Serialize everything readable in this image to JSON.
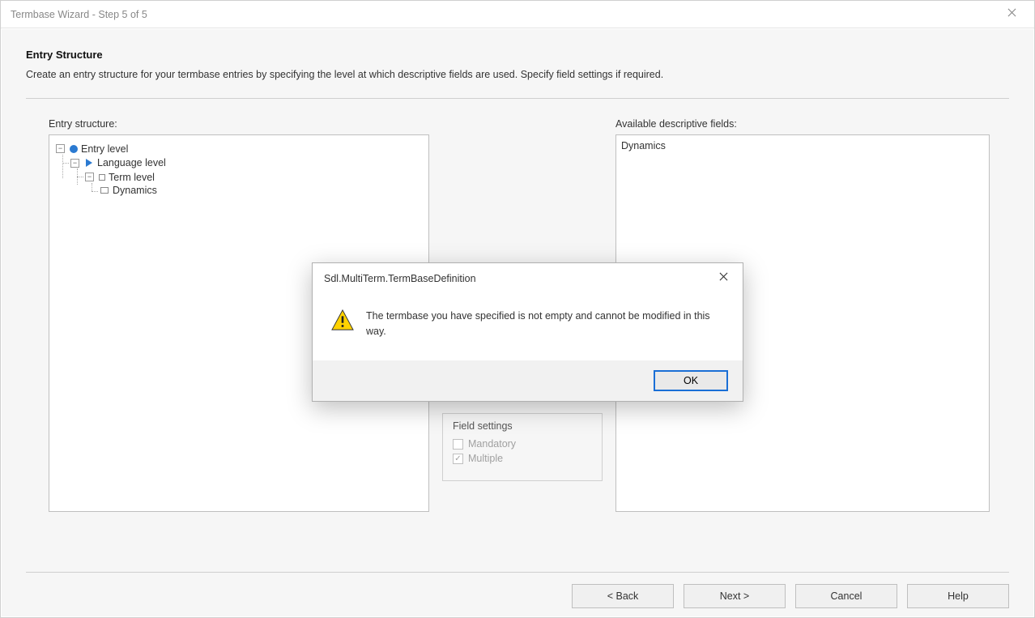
{
  "window": {
    "title": "Termbase Wizard - Step 5 of 5"
  },
  "page": {
    "heading": "Entry Structure",
    "subheading": "Create an entry structure for your termbase entries by specifying the level at which descriptive fields are used. Specify field settings if required."
  },
  "labels": {
    "entry_structure": "Entry structure:",
    "available_fields": "Available descriptive fields:",
    "field_settings": "Field settings"
  },
  "tree": {
    "root": "Entry level",
    "lang": "Language level",
    "term": "Term level",
    "field": "Dynamics"
  },
  "available_list": {
    "item0": "Dynamics"
  },
  "field_settings": {
    "mandatory": "Mandatory",
    "multiple": "Multiple"
  },
  "footer": {
    "back": "< Back",
    "next": "Next >",
    "cancel": "Cancel",
    "help": "Help"
  },
  "dialog": {
    "title": "Sdl.MultiTerm.TermBaseDefinition",
    "message": "The termbase you have specified is not empty and cannot be modified in this way.",
    "ok": "OK"
  }
}
